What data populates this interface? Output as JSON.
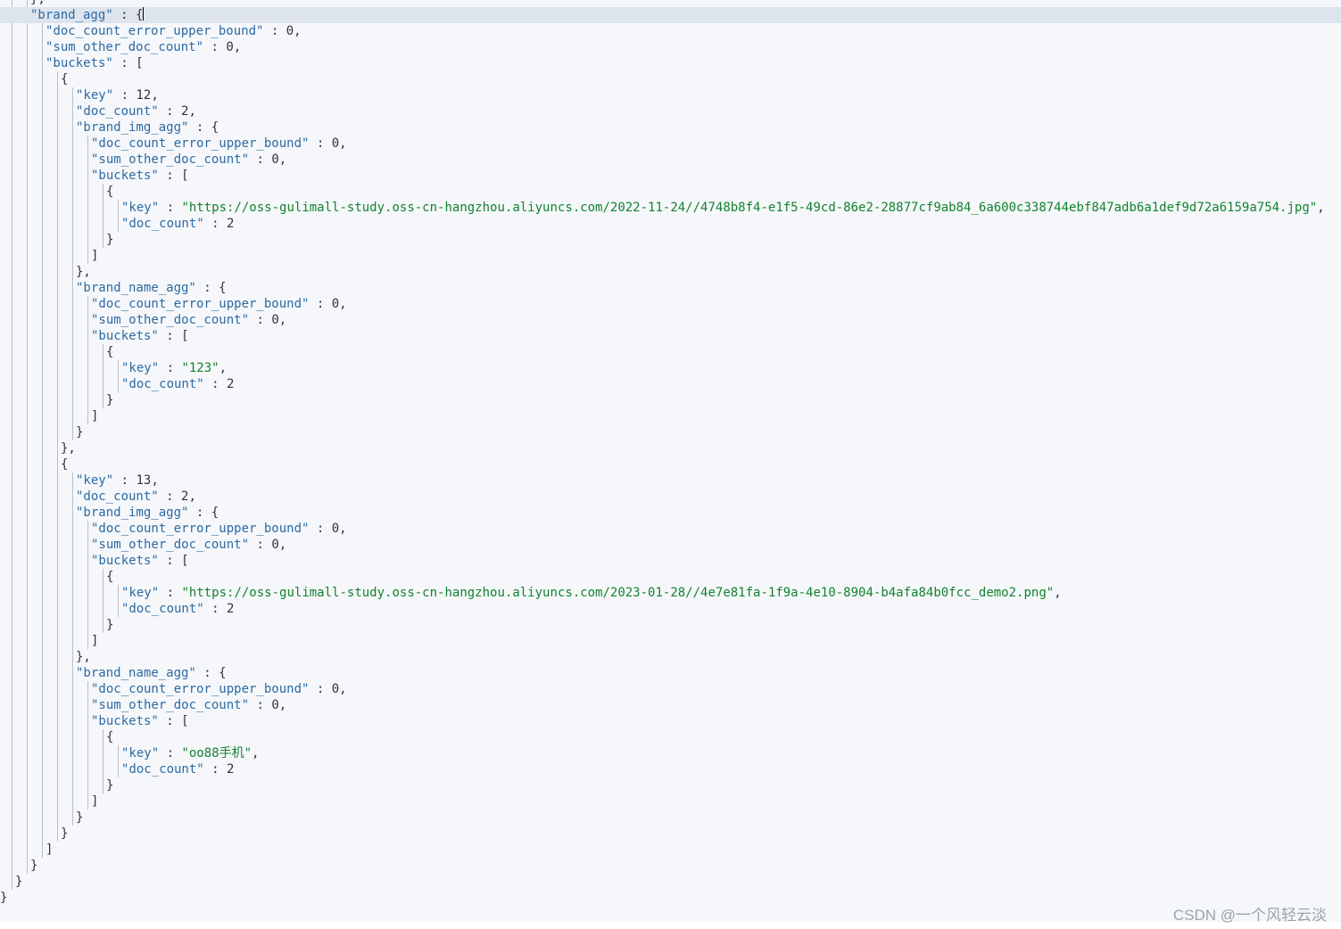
{
  "watermark": "CSDN @一个风轻云淡",
  "lines": [
    {
      "indent": 2,
      "tokens": [
        [
          "pun",
          "},"
        ]
      ],
      "clip": true
    },
    {
      "indent": 2,
      "tokens": [
        [
          "key",
          "\"brand_agg\""
        ],
        [
          "pun",
          " : {"
        ]
      ],
      "active": true,
      "cursor": true
    },
    {
      "indent": 3,
      "tokens": [
        [
          "key",
          "\"doc_count_error_upper_bound\""
        ],
        [
          "pun",
          " : "
        ],
        [
          "num",
          "0"
        ],
        [
          "pun",
          ","
        ]
      ]
    },
    {
      "indent": 3,
      "tokens": [
        [
          "key",
          "\"sum_other_doc_count\""
        ],
        [
          "pun",
          " : "
        ],
        [
          "num",
          "0"
        ],
        [
          "pun",
          ","
        ]
      ]
    },
    {
      "indent": 3,
      "tokens": [
        [
          "key",
          "\"buckets\""
        ],
        [
          "pun",
          " : ["
        ]
      ]
    },
    {
      "indent": 4,
      "tokens": [
        [
          "pun",
          "{"
        ]
      ]
    },
    {
      "indent": 5,
      "tokens": [
        [
          "key",
          "\"key\""
        ],
        [
          "pun",
          " : "
        ],
        [
          "num",
          "12"
        ],
        [
          "pun",
          ","
        ]
      ]
    },
    {
      "indent": 5,
      "tokens": [
        [
          "key",
          "\"doc_count\""
        ],
        [
          "pun",
          " : "
        ],
        [
          "num",
          "2"
        ],
        [
          "pun",
          ","
        ]
      ]
    },
    {
      "indent": 5,
      "tokens": [
        [
          "key",
          "\"brand_img_agg\""
        ],
        [
          "pun",
          " : {"
        ]
      ]
    },
    {
      "indent": 6,
      "tokens": [
        [
          "key",
          "\"doc_count_error_upper_bound\""
        ],
        [
          "pun",
          " : "
        ],
        [
          "num",
          "0"
        ],
        [
          "pun",
          ","
        ]
      ]
    },
    {
      "indent": 6,
      "tokens": [
        [
          "key",
          "\"sum_other_doc_count\""
        ],
        [
          "pun",
          " : "
        ],
        [
          "num",
          "0"
        ],
        [
          "pun",
          ","
        ]
      ]
    },
    {
      "indent": 6,
      "tokens": [
        [
          "key",
          "\"buckets\""
        ],
        [
          "pun",
          " : ["
        ]
      ]
    },
    {
      "indent": 7,
      "tokens": [
        [
          "pun",
          "{"
        ]
      ]
    },
    {
      "indent": 8,
      "tokens": [
        [
          "key",
          "\"key\""
        ],
        [
          "pun",
          " : "
        ],
        [
          "str",
          "\"https://oss-gulimall-study.oss-cn-hangzhou.aliyuncs.com/2022-11-24//4748b8f4-e1f5-49cd-86e2-28877cf9ab84_6a600c338744ebf847adb6a1def9d72a6159a754.jpg\""
        ],
        [
          "pun",
          ","
        ]
      ]
    },
    {
      "indent": 8,
      "tokens": [
        [
          "key",
          "\"doc_count\""
        ],
        [
          "pun",
          " : "
        ],
        [
          "num",
          "2"
        ]
      ]
    },
    {
      "indent": 7,
      "tokens": [
        [
          "pun",
          "}"
        ]
      ]
    },
    {
      "indent": 6,
      "tokens": [
        [
          "pun",
          "]"
        ]
      ]
    },
    {
      "indent": 5,
      "tokens": [
        [
          "pun",
          "},"
        ]
      ]
    },
    {
      "indent": 5,
      "tokens": [
        [
          "key",
          "\"brand_name_agg\""
        ],
        [
          "pun",
          " : {"
        ]
      ]
    },
    {
      "indent": 6,
      "tokens": [
        [
          "key",
          "\"doc_count_error_upper_bound\""
        ],
        [
          "pun",
          " : "
        ],
        [
          "num",
          "0"
        ],
        [
          "pun",
          ","
        ]
      ]
    },
    {
      "indent": 6,
      "tokens": [
        [
          "key",
          "\"sum_other_doc_count\""
        ],
        [
          "pun",
          " : "
        ],
        [
          "num",
          "0"
        ],
        [
          "pun",
          ","
        ]
      ]
    },
    {
      "indent": 6,
      "tokens": [
        [
          "key",
          "\"buckets\""
        ],
        [
          "pun",
          " : ["
        ]
      ]
    },
    {
      "indent": 7,
      "tokens": [
        [
          "pun",
          "{"
        ]
      ]
    },
    {
      "indent": 8,
      "tokens": [
        [
          "key",
          "\"key\""
        ],
        [
          "pun",
          " : "
        ],
        [
          "str",
          "\"123\""
        ],
        [
          "pun",
          ","
        ]
      ]
    },
    {
      "indent": 8,
      "tokens": [
        [
          "key",
          "\"doc_count\""
        ],
        [
          "pun",
          " : "
        ],
        [
          "num",
          "2"
        ]
      ]
    },
    {
      "indent": 7,
      "tokens": [
        [
          "pun",
          "}"
        ]
      ]
    },
    {
      "indent": 6,
      "tokens": [
        [
          "pun",
          "]"
        ]
      ]
    },
    {
      "indent": 5,
      "tokens": [
        [
          "pun",
          "}"
        ]
      ]
    },
    {
      "indent": 4,
      "tokens": [
        [
          "pun",
          "},"
        ]
      ]
    },
    {
      "indent": 4,
      "tokens": [
        [
          "pun",
          "{"
        ]
      ]
    },
    {
      "indent": 5,
      "tokens": [
        [
          "key",
          "\"key\""
        ],
        [
          "pun",
          " : "
        ],
        [
          "num",
          "13"
        ],
        [
          "pun",
          ","
        ]
      ]
    },
    {
      "indent": 5,
      "tokens": [
        [
          "key",
          "\"doc_count\""
        ],
        [
          "pun",
          " : "
        ],
        [
          "num",
          "2"
        ],
        [
          "pun",
          ","
        ]
      ]
    },
    {
      "indent": 5,
      "tokens": [
        [
          "key",
          "\"brand_img_agg\""
        ],
        [
          "pun",
          " : {"
        ]
      ]
    },
    {
      "indent": 6,
      "tokens": [
        [
          "key",
          "\"doc_count_error_upper_bound\""
        ],
        [
          "pun",
          " : "
        ],
        [
          "num",
          "0"
        ],
        [
          "pun",
          ","
        ]
      ]
    },
    {
      "indent": 6,
      "tokens": [
        [
          "key",
          "\"sum_other_doc_count\""
        ],
        [
          "pun",
          " : "
        ],
        [
          "num",
          "0"
        ],
        [
          "pun",
          ","
        ]
      ]
    },
    {
      "indent": 6,
      "tokens": [
        [
          "key",
          "\"buckets\""
        ],
        [
          "pun",
          " : ["
        ]
      ]
    },
    {
      "indent": 7,
      "tokens": [
        [
          "pun",
          "{"
        ]
      ]
    },
    {
      "indent": 8,
      "tokens": [
        [
          "key",
          "\"key\""
        ],
        [
          "pun",
          " : "
        ],
        [
          "str",
          "\"https://oss-gulimall-study.oss-cn-hangzhou.aliyuncs.com/2023-01-28//4e7e81fa-1f9a-4e10-8904-b4afa84b0fcc_demo2.png\""
        ],
        [
          "pun",
          ","
        ]
      ]
    },
    {
      "indent": 8,
      "tokens": [
        [
          "key",
          "\"doc_count\""
        ],
        [
          "pun",
          " : "
        ],
        [
          "num",
          "2"
        ]
      ]
    },
    {
      "indent": 7,
      "tokens": [
        [
          "pun",
          "}"
        ]
      ]
    },
    {
      "indent": 6,
      "tokens": [
        [
          "pun",
          "]"
        ]
      ]
    },
    {
      "indent": 5,
      "tokens": [
        [
          "pun",
          "},"
        ]
      ]
    },
    {
      "indent": 5,
      "tokens": [
        [
          "key",
          "\"brand_name_agg\""
        ],
        [
          "pun",
          " : {"
        ]
      ]
    },
    {
      "indent": 6,
      "tokens": [
        [
          "key",
          "\"doc_count_error_upper_bound\""
        ],
        [
          "pun",
          " : "
        ],
        [
          "num",
          "0"
        ],
        [
          "pun",
          ","
        ]
      ]
    },
    {
      "indent": 6,
      "tokens": [
        [
          "key",
          "\"sum_other_doc_count\""
        ],
        [
          "pun",
          " : "
        ],
        [
          "num",
          "0"
        ],
        [
          "pun",
          ","
        ]
      ]
    },
    {
      "indent": 6,
      "tokens": [
        [
          "key",
          "\"buckets\""
        ],
        [
          "pun",
          " : ["
        ]
      ]
    },
    {
      "indent": 7,
      "tokens": [
        [
          "pun",
          "{"
        ]
      ]
    },
    {
      "indent": 8,
      "tokens": [
        [
          "key",
          "\"key\""
        ],
        [
          "pun",
          " : "
        ],
        [
          "str",
          "\"oo88手机\""
        ],
        [
          "pun",
          ","
        ]
      ]
    },
    {
      "indent": 8,
      "tokens": [
        [
          "key",
          "\"doc_count\""
        ],
        [
          "pun",
          " : "
        ],
        [
          "num",
          "2"
        ]
      ]
    },
    {
      "indent": 7,
      "tokens": [
        [
          "pun",
          "}"
        ]
      ]
    },
    {
      "indent": 6,
      "tokens": [
        [
          "pun",
          "]"
        ]
      ]
    },
    {
      "indent": 5,
      "tokens": [
        [
          "pun",
          "}"
        ]
      ]
    },
    {
      "indent": 4,
      "tokens": [
        [
          "pun",
          "}"
        ]
      ]
    },
    {
      "indent": 3,
      "tokens": [
        [
          "pun",
          "]"
        ]
      ]
    },
    {
      "indent": 2,
      "tokens": [
        [
          "pun",
          "}"
        ]
      ]
    },
    {
      "indent": 1,
      "tokens": [
        [
          "pun",
          "}"
        ]
      ]
    },
    {
      "indent": 0,
      "tokens": [
        [
          "pun",
          "}"
        ]
      ]
    }
  ]
}
